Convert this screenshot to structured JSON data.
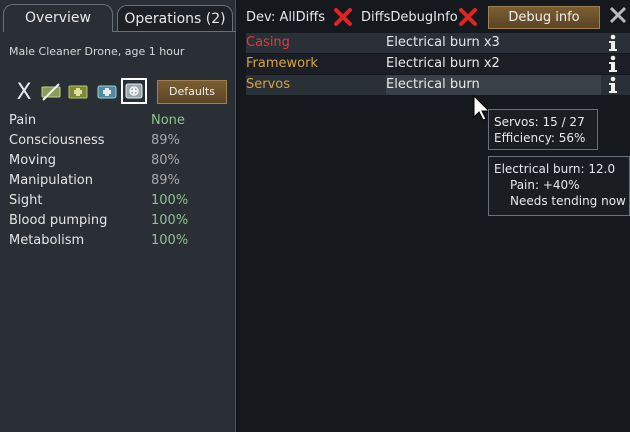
{
  "tabs": {
    "overview": "Overview",
    "operations": "Operations (2)"
  },
  "pawn": {
    "description": "Male Cleaner Drone, age 1 hour"
  },
  "toolbar": {
    "icons": [
      "x-icon",
      "medicine-slash-icon",
      "herbal-medicine-icon",
      "industrial-medicine-icon",
      "glitterworld-medicine-icon"
    ],
    "x_glyph": "X",
    "defaults_label": "Defaults"
  },
  "capacities": [
    {
      "name": "Pain",
      "value": "None"
    },
    {
      "name": "Consciousness",
      "value": "89%"
    },
    {
      "name": "Moving",
      "value": "80%"
    },
    {
      "name": "Manipulation",
      "value": "89%"
    },
    {
      "name": "Sight",
      "value": "100%"
    },
    {
      "name": "Blood pumping",
      "value": "100%"
    },
    {
      "name": "Metabolism",
      "value": "100%"
    }
  ],
  "dev": {
    "all_diffs": "Dev: AllDiffs",
    "diffs_debug_info": "DiffsDebugInfo",
    "debug_info_button": "Debug info"
  },
  "health_rows": [
    {
      "part": "Casing",
      "condition": "Electrical burn x3"
    },
    {
      "part": "Framework",
      "condition": "Electrical burn x2"
    },
    {
      "part": "Servos",
      "condition": "Electrical burn"
    }
  ],
  "colors": {
    "part_casing": "#e03a3a",
    "part_framework": "#d7a43b",
    "part_servos": "#d7a43b",
    "value_good": "#8fc28f",
    "value_neutral": "#a8a8a8",
    "button_brown": "#6b5029",
    "x_red": "#e02424"
  },
  "tooltip_part": {
    "line1": "Servos:  15 / 27",
    "line2": "Efficiency: 56%"
  },
  "tooltip_hediff": {
    "line1": "Electrical burn: 12.0",
    "line2": "Pain: +40%",
    "line3": "Needs tending now"
  }
}
